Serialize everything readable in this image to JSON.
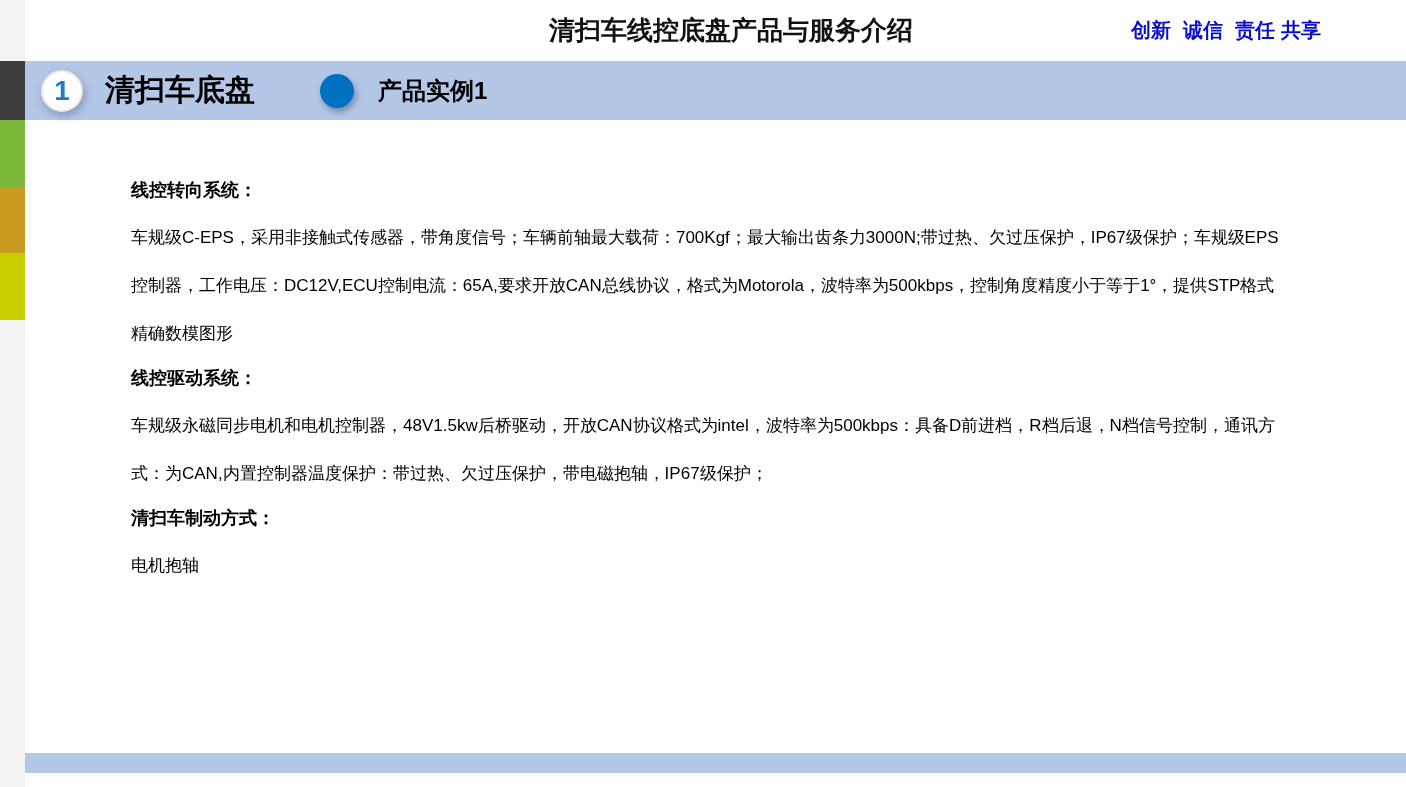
{
  "slide": {
    "title": "清扫车线控底盘产品与服务介绍",
    "motto": [
      "创新",
      "诚信",
      "责任 共享"
    ],
    "section": {
      "number": "1",
      "name": "清扫车底盘"
    },
    "subsection": {
      "name": "产品实例1"
    },
    "blocks": [
      {
        "kind": "heading",
        "text": "线控转向系统："
      },
      {
        "kind": "paragraph",
        "text": "车规级C-EPS，采用非接触式传感器，带角度信号；车辆前轴最大载荷：700Kgf；最大输出齿条力3000N;带过热、欠过压保护，IP67级保护；车规级EPS控制器，工作电压：DC12V,ECU控制电流：65A,要求开放CAN总线协议，格式为Motorola，波特率为500kbps，控制角度精度小于等于1°，提供STP格式精确数模图形"
      },
      {
        "kind": "heading",
        "text": "**线控驱动系统**："
      },
      {
        "kind": "paragraph",
        "text": "车规级永磁同步电机和电机控制器，48V1.5kw后桥驱动，开放CAN协议格式为intel，波特率为500kbps：具备D前进档，R档后退，N档信号控制，通讯方式：为CAN,内置控制器温度保护：带过热、欠过压保护，带电磁抱轴，IP67级保护；"
      },
      {
        "kind": "heading",
        "text": "**清扫车制动方式**："
      },
      {
        "kind": "paragraph",
        "text": "电机抱轴"
      }
    ]
  }
}
